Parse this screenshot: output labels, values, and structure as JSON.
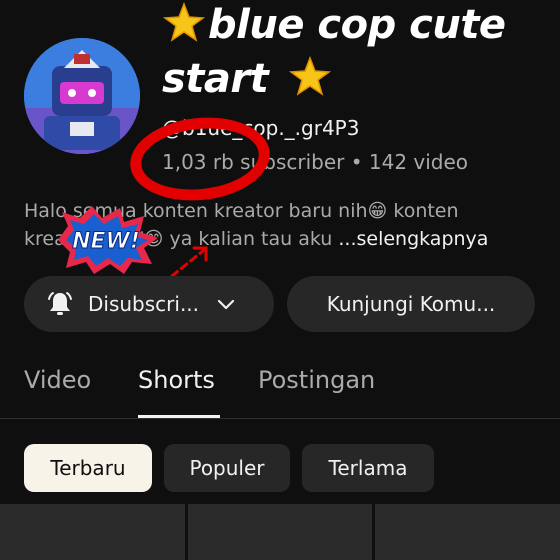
{
  "channel": {
    "title_line1": "blue cop cute",
    "title_line2": "start",
    "handle": "@b1ue_cop._.gr4P3",
    "stats": "1,03 rb subscriber • 142 video",
    "description_line1": "Halo semua konten kreator baru nih😁 konten",
    "description_line2": "kreator NEW😊 ya kalian tau aku",
    "more_label": "...selengkapnya"
  },
  "sticker": {
    "text": "NEW!"
  },
  "actions": {
    "subscribed_label": "Disubscri...",
    "community_label": "Kunjungi Komu..."
  },
  "tabs": [
    {
      "label": "Video"
    },
    {
      "label": "Shorts"
    },
    {
      "label": "Postingan"
    }
  ],
  "filters": [
    {
      "label": "Terbaru"
    },
    {
      "label": "Populer"
    },
    {
      "label": "Terlama"
    }
  ],
  "colors": {
    "background": "#0f0f0f",
    "pill": "#272727",
    "annotation_red": "#e30000",
    "star": "#f5c518",
    "active_chip": "#f8f3e8"
  },
  "icons": {
    "title_decoration": "sparkle-star-icon",
    "bell": "bell-icon",
    "dropdown": "chevron-down-icon"
  }
}
